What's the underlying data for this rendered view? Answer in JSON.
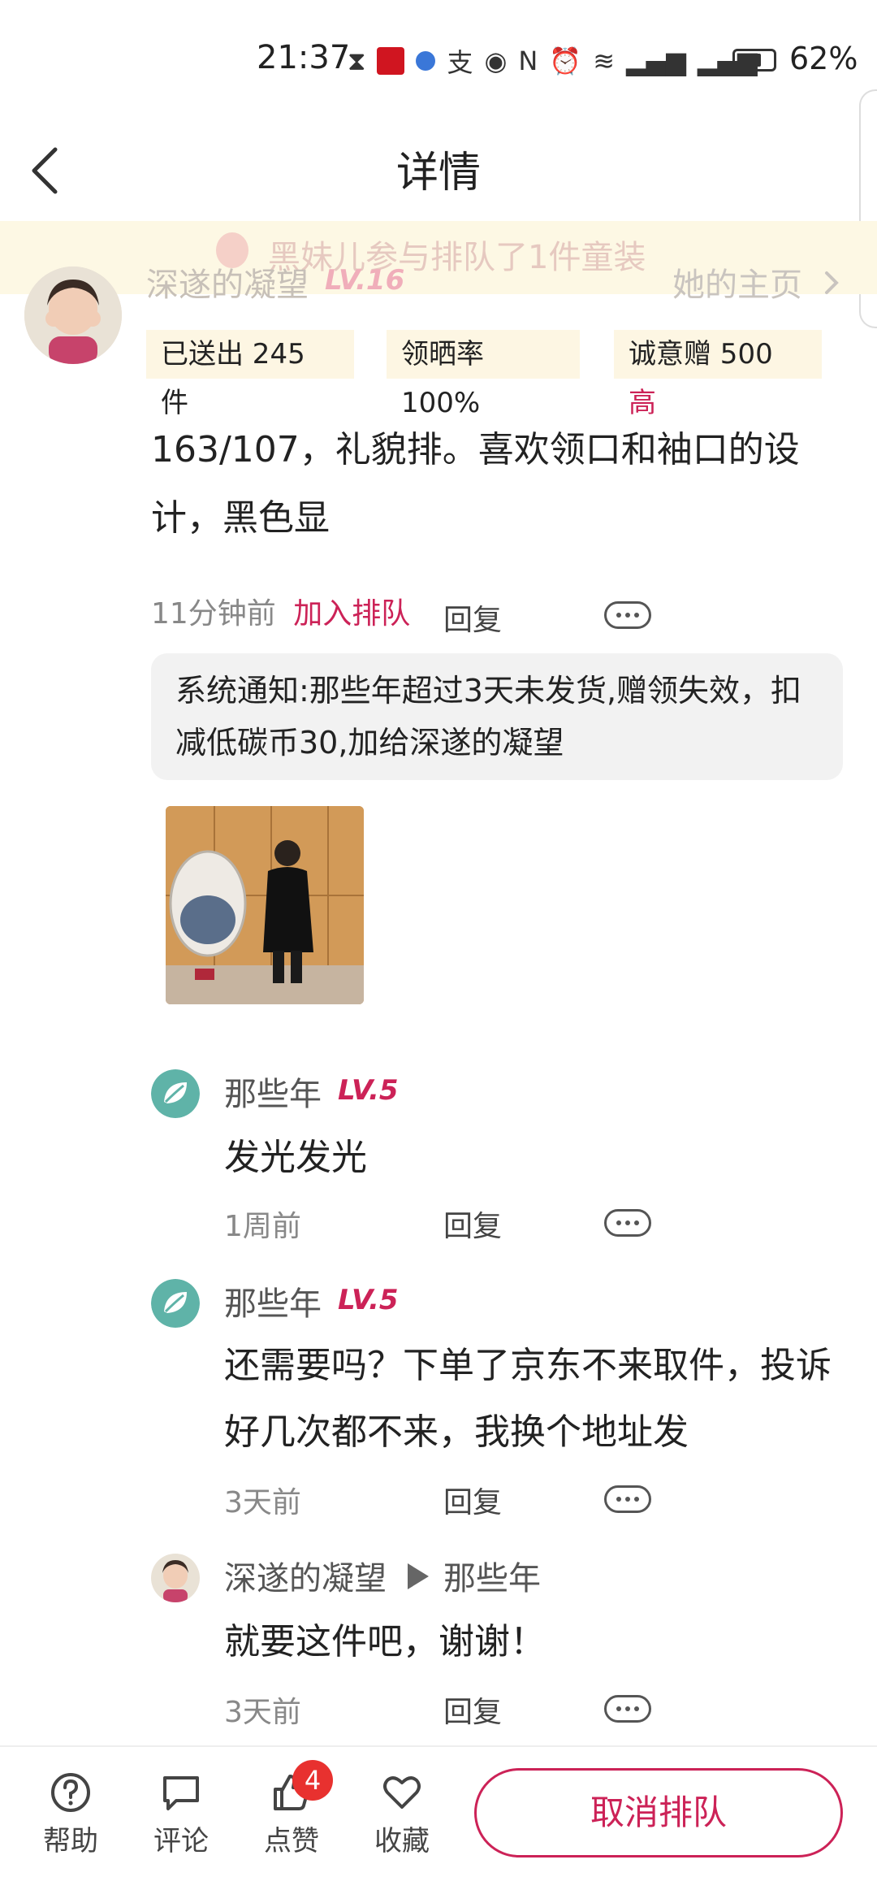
{
  "status_bar": {
    "time": "21:37",
    "battery_pct": "62%"
  },
  "header": {
    "title": "详情"
  },
  "banner": {
    "text": "黑妹儿参与排队了1件童装"
  },
  "post": {
    "username": "深遂的凝望",
    "level": "LV.16",
    "home_link": "她的主页",
    "stats": {
      "sent": "已送出 245 件",
      "rate": "领晒率 100%",
      "sincerity_label": "诚意赠 500",
      "sincerity_level": "高"
    },
    "text": "163/107，礼貌排。喜欢领口和袖口的设计，黑色显",
    "time": "11分钟前",
    "join_label": "加入排队",
    "reply_label": "回复",
    "system_notice": "系统通知:那些年超过3天未发货,赠领失效，扣减低碳币30,加给深遂的凝望"
  },
  "comments": [
    {
      "name": "那些年",
      "level": "LV.5",
      "text": "发光发光",
      "time": "1周前",
      "reply": "回复"
    },
    {
      "name": "那些年",
      "level": "LV.5",
      "text": "还需要吗？下单了京东不来取件，投诉好几次都不来，我换个地址发",
      "time": "3天前",
      "reply": "回复"
    },
    {
      "name": "深遂的凝望",
      "reply_to": "那些年",
      "text": "就要这件吧，谢谢！",
      "time": "3天前",
      "reply": "回复"
    }
  ],
  "bottom_bar": {
    "help": "帮助",
    "comment": "评论",
    "like": "点赞",
    "like_count": "4",
    "favorite": "收藏",
    "cancel": "取消排队"
  },
  "colors": {
    "accent": "#cc2257",
    "badge": "#e8312f",
    "banner_bg": "#fdf8e4",
    "stat_bg": "#fdf6e3"
  }
}
